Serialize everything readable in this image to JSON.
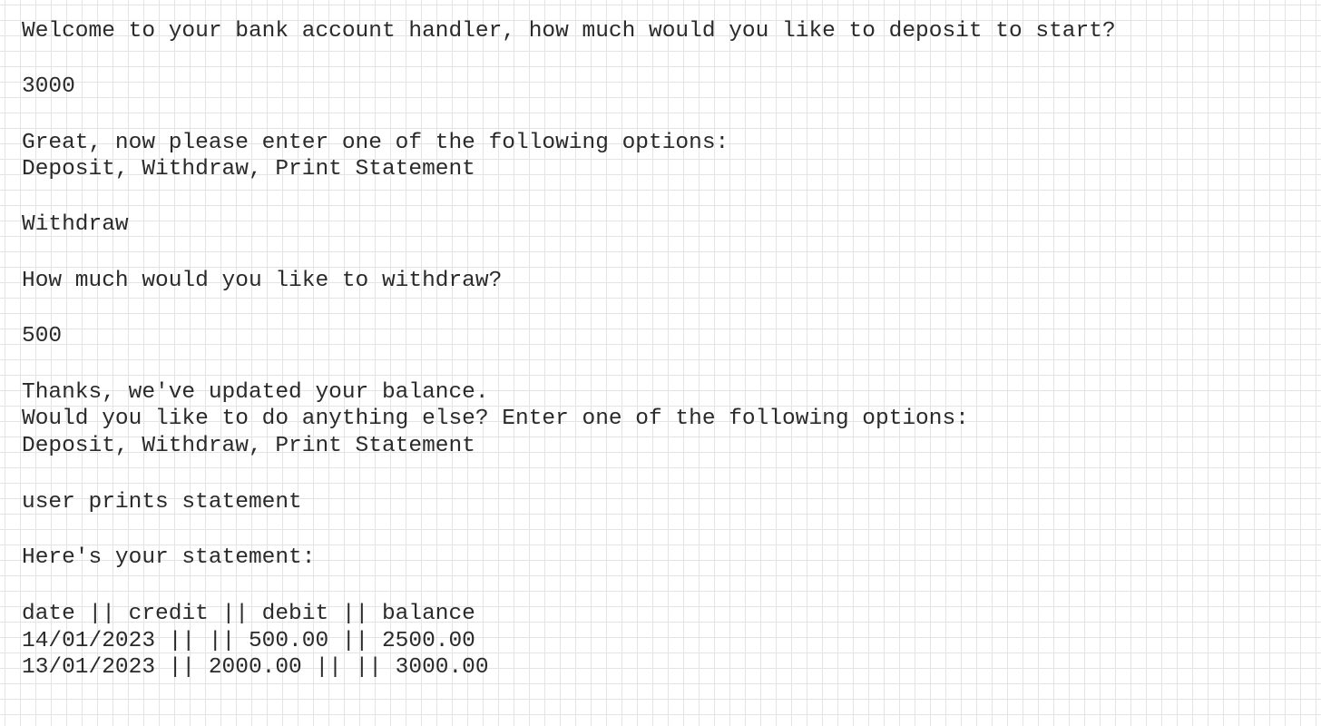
{
  "transcript": {
    "welcome_prompt": "Welcome to your bank account handler, how much would you like to deposit to start?",
    "initial_deposit_input": "3000",
    "options_intro": "Great, now please enter one of the following options:",
    "options_list_1": "Deposit, Withdraw, Print Statement",
    "user_choice_1": "Withdraw",
    "withdraw_prompt": "How much would you like to withdraw?",
    "withdraw_amount_input": "500",
    "balance_updated_msg": "Thanks, we've updated your balance.",
    "anything_else_prompt": "Would you like to do anything else? Enter one of the following options:",
    "options_list_2": "Deposit, Withdraw, Print Statement",
    "user_choice_2": "user prints statement",
    "statement_intro": "Here's your statement:",
    "statement": {
      "header": "date || credit || debit || balance",
      "rows": [
        "14/01/2023 || || 500.00 || 2500.00",
        "13/01/2023 || 2000.00 || || 3000.00"
      ]
    }
  }
}
